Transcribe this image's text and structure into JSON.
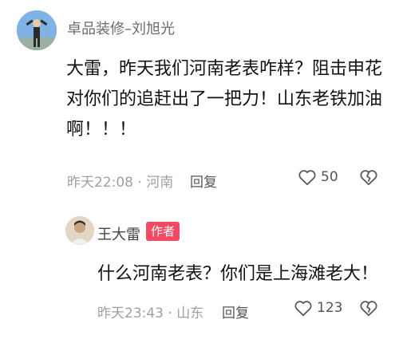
{
  "comment": {
    "user": "卓品装修–刘旭光",
    "text": "大雷，昨天我们河南老表咋样？阻击申花对你们的追赶出了一把力！山东老铁加油啊！！！",
    "time_location": "昨天22:08 · 河南",
    "reply_label": "回复",
    "likes": "50"
  },
  "reply": {
    "user": "王大雷",
    "badge": "作者",
    "text": "什么河南老表？你们是上海滩老大！",
    "time_location": "昨天23:43 · 山东",
    "reply_label": "回复",
    "likes": "123"
  },
  "icons": {
    "like": "heart-outline-icon",
    "dislike": "broken-heart-outline-icon"
  }
}
